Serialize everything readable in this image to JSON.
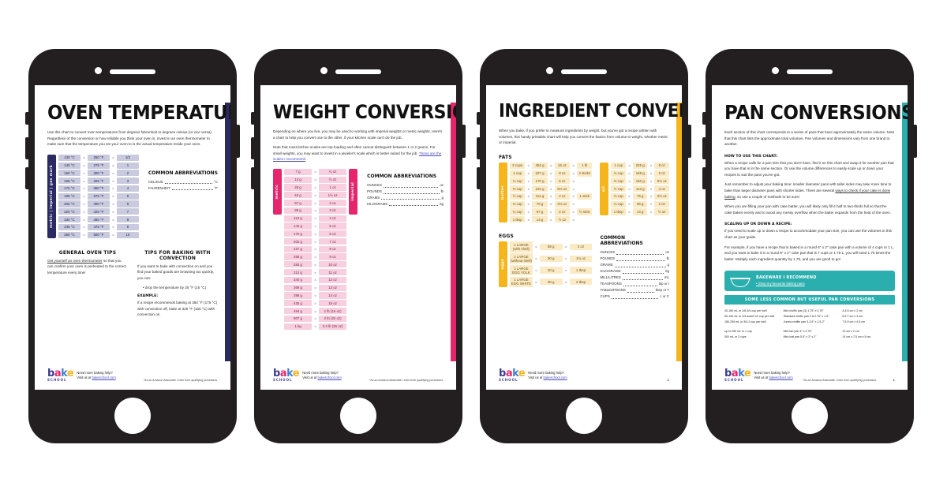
{
  "phones": [
    {
      "id": "oven",
      "accent": "#2b2b63",
      "title": "OVEN TEMPERATURES",
      "intro": "Use this chart to convert oven temperatures from degrees fahrenheit to degrees celsius (or vice versa). Regardless of the conversion or how reliable you think your oven is, invest in an oven thermometer to make sure that the temperature you set your oven to is the actual temperature inside your oven.",
      "rail_label": "metric | imperial | gas mark",
      "table": [
        [
          "130 °C",
          "250 °F",
          "1/2"
        ],
        [
          "140 °C",
          "275 °F",
          "1"
        ],
        [
          "150 °C",
          "300 °F",
          "2"
        ],
        [
          "165 °C",
          "325 °F",
          "3"
        ],
        [
          "175 °C",
          "350 °F",
          "4"
        ],
        [
          "190 °C",
          "375 °F",
          "5"
        ],
        [
          "200 °C",
          "400 °F",
          "6"
        ],
        [
          "220 °C",
          "425 °F",
          "7"
        ],
        [
          "230 °C",
          "450 °F",
          "8"
        ],
        [
          "245 °C",
          "475 °F",
          "9"
        ],
        [
          "260 °C",
          "500 °F",
          "10"
        ]
      ],
      "abbr_title": "COMMON ABBREVIATIONS",
      "abbr": [
        {
          "k": "CELSIUS",
          "v": "°C"
        },
        {
          "k": "FAHRENHEIT",
          "v": "°F"
        }
      ],
      "tips": [
        {
          "head": "GENERAL OVEN TIPS",
          "link": "Get yourself an oven thermometer",
          "body": " so that you can confirm your oven is preheated to the correct temperature every time!"
        },
        {
          "head": "TIPS FOR BAKING WITH CONVECTION",
          "body": "If you want to bake with convection on and you find your baked goods are browning too quickly, you can:",
          "bullet": "drop the temperature by 25 °F (15 °C)",
          "example_head": "EXAMPLE:",
          "example": "If a recipe recommends baking at 350 °F (175 °C) with convection off, bake at 325 °F (165 °C) with convection on."
        }
      ],
      "footer": {
        "logo_parts": [
          "b",
          "a",
          "k",
          "e"
        ],
        "logo_sub": "SCHOOL",
        "cta_line1": "Need more baking help?",
        "cta_line2_pre": "Visit us at ",
        "cta_link": "bakeschool.com",
        "note": "*As an Amazon Associate I earn from qualifying purchases."
      }
    },
    {
      "id": "weight",
      "accent": "#e5266d",
      "title": "WEIGHT CONVERSIONS",
      "intro": "Depending on where you live, you may be used to working with imperial weights or metric weights. Here's a chart to help you convert one to the other, if your kitchen scale can't do the job.",
      "intro2_pre": "Note that most kitchen scales are top-loading and often cannot distinguish between 1 or 2 grams. For small weights, you may want to invest in a jeweler's scale which is better suited for the job. ",
      "intro2_link": "These are the scales I recommend",
      "rail_left": "metric",
      "rail_right": "imperial",
      "table": [
        [
          "7 g",
          "¼ oz"
        ],
        [
          "14 g",
          "½ oz"
        ],
        [
          "28 g",
          "1 oz"
        ],
        [
          "43 g",
          "1½ oz"
        ],
        [
          "57 g",
          "2 oz"
        ],
        [
          "85 g",
          "3 oz"
        ],
        [
          "113 g",
          "4 oz"
        ],
        [
          "142 g",
          "5 oz"
        ],
        [
          "170 g",
          "6 oz"
        ],
        [
          "200 g",
          "7 oz"
        ],
        [
          "227 g",
          "8 oz"
        ],
        [
          "255 g",
          "9 oz"
        ],
        [
          "283 g",
          "10 oz"
        ],
        [
          "312 g",
          "11 oz"
        ],
        [
          "340 g",
          "12 oz"
        ],
        [
          "369 g",
          "13 oz"
        ],
        [
          "398 g",
          "14 oz"
        ],
        [
          "425 g",
          "15 oz"
        ],
        [
          "454 g",
          "1 lb (16 oz)"
        ],
        [
          "907 g",
          "2 lb (32 oz)"
        ],
        [
          "1 kg",
          "2.2 lb (35 oz)"
        ]
      ],
      "abbr_title": "COMMON ABBREVIATIONS",
      "abbr": [
        {
          "k": "OUNCES",
          "v": "oz"
        },
        {
          "k": "POUNDS",
          "v": "lb"
        },
        {
          "k": "GRAMS",
          "v": "g"
        },
        {
          "k": "KILOGRAMS",
          "v": "kg"
        }
      ],
      "footer": {
        "logo_parts": [
          "b",
          "a",
          "k",
          "e"
        ],
        "logo_sub": "SCHOOL",
        "cta_line1": "Need more baking help?",
        "cta_line2_pre": "Visit us at ",
        "cta_link": "bakeschool.com",
        "note": "*As an Amazon Associate I earn from qualifying purchases."
      }
    },
    {
      "id": "ingredient",
      "accent": "#f5b51c",
      "title": "INGREDIENT CONVERSIONS",
      "intro": "When you bake, if you prefer to measure ingredients by weight, but you've got a recipe written with volumes, this handy printable chart will help you convert the basics from volume to weight, whether metric or imperial.",
      "fats_head": "FATS",
      "butter_rail": "butter",
      "butter": [
        [
          "2 cups",
          "454 g",
          "16 oz",
          "1 lb"
        ],
        [
          "1 cup",
          "227 g",
          "8 oz",
          "2 sticks"
        ],
        [
          "¾ cup",
          "170 g",
          "6 oz",
          ""
        ],
        [
          "⅔ cup",
          "152 g",
          "5⅓ oz",
          ""
        ],
        [
          "½ cup",
          "114 g",
          "4 oz",
          "1 stick"
        ],
        [
          "⅓ cup",
          "76 g",
          "2⅔ oz",
          ""
        ],
        [
          "¼ cup",
          "57 g",
          "2 oz",
          "½ stick"
        ],
        [
          "1 tbsp",
          "14 g",
          "½ oz",
          ""
        ]
      ],
      "oil_rail": "oil",
      "oil": [
        [
          "1 cup",
          "225 g",
          "8 oz"
        ],
        [
          "¾ cup",
          "169 g",
          "6 oz"
        ],
        [
          "⅔ cup",
          "150 g",
          "5⅓ oz"
        ],
        [
          "½ cup",
          "113 g",
          "4 oz"
        ],
        [
          "⅓ cup",
          "75 g",
          "2⅔ oz"
        ],
        [
          "¼ cup",
          "56 g",
          "2 oz"
        ],
        [
          "1 tbsp",
          "14 g",
          "½ oz"
        ]
      ],
      "eggs_head": "EGGS",
      "eggs_rail": "eggs",
      "eggs": [
        [
          "1 LARGE (with shell)",
          "58 g",
          "2 oz"
        ],
        [
          "1 LARGE (without shell)",
          "50 g",
          "1¾ oz"
        ],
        [
          "1 LARGE EGG YOLK",
          "20 g",
          "1 tbsp"
        ],
        [
          "1 LARGE EGG WHITE",
          "30 g",
          "2 tbsp"
        ]
      ],
      "abbr_title": "COMMON ABBREVIATIONS",
      "abbr": [
        {
          "k": "OUNCES",
          "v": "oz"
        },
        {
          "k": "POUNDS",
          "v": "lb"
        },
        {
          "k": "GRAMS",
          "v": "g"
        },
        {
          "k": "KILOGRAMS",
          "v": "kg"
        },
        {
          "k": "MILLILITRES",
          "v": "mL"
        },
        {
          "k": "TEASPOONS",
          "v": "tsp or t"
        },
        {
          "k": "TABLESPOONS",
          "v": "tbsp or T"
        },
        {
          "k": "CUPS",
          "v": "c or C"
        }
      ],
      "page_number": "1",
      "footer": {
        "logo_parts": [
          "b",
          "a",
          "k",
          "e"
        ],
        "logo_sub": "SCHOOL",
        "cta_line1": "Need more baking help?",
        "cta_line2_pre": "Visit us at ",
        "cta_link": "bakeschool.com",
        "note": "*As an Amazon Associate I earn from qualifying purchases."
      }
    },
    {
      "id": "pan",
      "accent": "#2bafae",
      "title": "PAN CONVERSIONS",
      "intro": "Each section of this chart corresponds to a series of pans that have approximately the same volume. Note that this chart lists the approximate total volumes. Pan volumes and dimensions vary from one brand to another.",
      "howto_head": "HOW TO USE THIS CHART:",
      "howto_1": "When a recipe calls for a pan size that you don't have, find it on this chart and swap it for another pan that you have that is in the same section. Or use the volume differences to easily scale up or down your recipes to suit the pans you've got.",
      "howto_2_pre": "Just remember to adjust your baking time: smaller diameter pans with taller sides may take more time to bake than larger diameter pans with shorter sides. There are several ",
      "howto_2_link": "ways to check if your cake is done baking",
      "howto_2_post": ", so use a couple of methods to be sure!",
      "howto_3": "When you are filling your pan with cake batter, you will likely only fill it half to two-thirds full so that the cake bakes evenly and to avoid any messy overflow when the batter expands from the heat of the oven.",
      "scaling_head": "SCALING UP OR DOWN A RECIPE:",
      "scaling_1": "If you need to scale up or down a recipe to accommodate your pan size, you can use the volumes in this chart as your guide.",
      "scaling_2": "For example, if you have a recipe that is baked in a round 6\" x 2\" cake pan with a volume of 4 cups or 1 L, and you want to bake it in a round 8\" x 2\" cake pan that is 7 cups or 1.75 L, you will need 1.75 times the batter. Multiply each ingredient quantity by 1.75, and you are good to go!",
      "cta_title": "BAKEWARE I RECOMMEND",
      "cta_link": "Shop my favourite baking pans",
      "band": "SOME LESS COMMON BUT USEFUL PAN CONVERSIONS",
      "pan_cols": [
        [
          "30-180 mL or 1/8-3/4 cup per well",
          "60-100 mL or 1/3-scant 1/2 cup per well",
          "180-250 mL or 3/4-1 cup per well",
          "",
          "up to 250 mL or 1 cup",
          "500 mL or 2 cups"
        ],
        [
          "Mini muffin pan (3) 1.75\" x 0.75\"",
          "Standard muffin pan 2.5-2.75\" x 1.5\"",
          "Jumbo muffin pan 3-3.5\" x 1.5-2\"",
          "",
          "Mini tart pan 4\" x 0.75\"",
          "Mini loaf pan 5.5\" x 3\" x 2\""
        ],
        [
          "4-4.5 cm x 2 cm",
          "6.5-7 cm x 4 cm",
          "7.5-9 cm x 4-5 cm",
          "",
          "10 cm x 2 cm",
          "14 cm x 7.5 cm x 5 cm"
        ]
      ],
      "page_number": "1",
      "footer": {
        "logo_parts": [
          "b",
          "a",
          "k",
          "e"
        ],
        "logo_sub": "SCHOOL",
        "cta_line1": "Need more baking help?",
        "cta_line2_pre": "Visit us at ",
        "cta_link": "bakeschool.com",
        "note": "*As an Amazon Associate I earn from qualifying purchases."
      }
    }
  ]
}
